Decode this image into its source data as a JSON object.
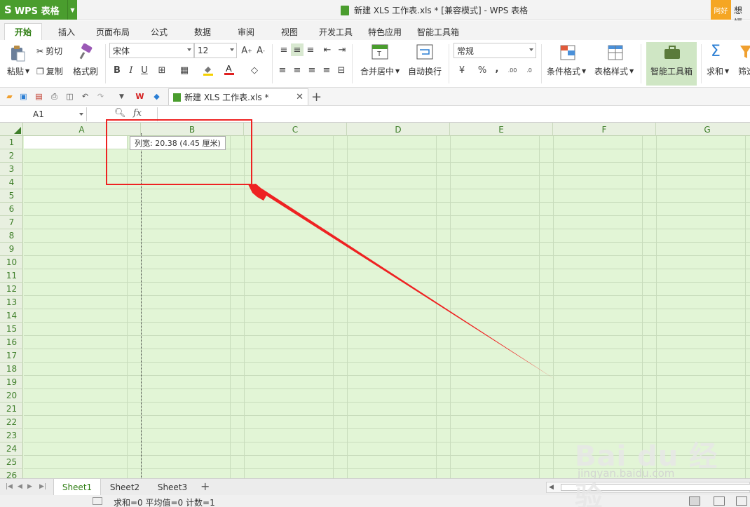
{
  "app": {
    "logo": "S",
    "name": "WPS 表格",
    "document_title": "新建 XLS 工作表.xls * [兼容模式] - WPS 表格",
    "user_badge": "阿好",
    "user_text": "想福"
  },
  "tabs": [
    {
      "label": "开始",
      "active": true
    },
    {
      "label": "插入"
    },
    {
      "label": "页面布局"
    },
    {
      "label": "公式"
    },
    {
      "label": "数据"
    },
    {
      "label": "审阅"
    },
    {
      "label": "视图"
    },
    {
      "label": "开发工具"
    },
    {
      "label": "特色应用"
    },
    {
      "label": "智能工具箱"
    }
  ],
  "ribbon": {
    "paste": "粘贴",
    "cut": "剪切",
    "copy": "复制",
    "format_painter": "格式刷",
    "font_name": "宋体",
    "font_size": "12",
    "bold": "B",
    "italic": "I",
    "underline": "U",
    "merge_center": "合并居中",
    "wrap_text": "自动换行",
    "number_format": "常规",
    "percent": "%",
    "comma": ",",
    "cond_format": "条件格式",
    "table_style": "表格样式",
    "smart_toolbox": "智能工具箱",
    "sum": "求和",
    "filter": "筛选"
  },
  "quick_access": {
    "doc_tab_label": "新建 XLS 工作表.xls *"
  },
  "formula_bar": {
    "name_box": "A1",
    "fx": "fx"
  },
  "grid": {
    "columns": [
      "A",
      "B",
      "C",
      "D",
      "E",
      "F",
      "G"
    ],
    "rows": [
      "1",
      "2",
      "3",
      "4",
      "5",
      "6",
      "7",
      "8",
      "9",
      "10",
      "11",
      "12",
      "13",
      "14",
      "15",
      "16",
      "17",
      "18",
      "19",
      "20",
      "21",
      "22",
      "23",
      "24",
      "25",
      "26"
    ]
  },
  "tooltip": {
    "text": "列宽: 20.38 (4.45 厘米)"
  },
  "sheets": [
    {
      "label": "Sheet1",
      "active": true
    },
    {
      "label": "Sheet2"
    },
    {
      "label": "Sheet3"
    }
  ],
  "status": {
    "text": "求和=0  平均值=0  计数=1"
  },
  "watermark": {
    "big": "Bai du 经验",
    "small": "jingyan.baidu.com"
  },
  "colors": {
    "brand_green": "#4a9d2e",
    "grid_bg": "#e2f5d6",
    "annotation_red": "#ee2222"
  }
}
